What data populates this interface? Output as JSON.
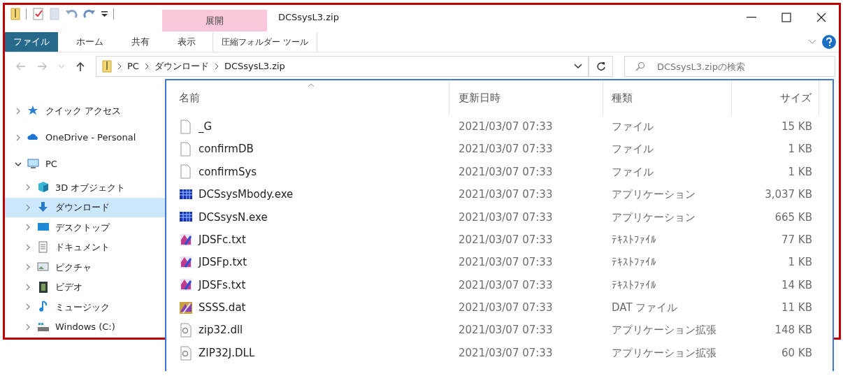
{
  "window": {
    "title": "DCSsysL3.zip"
  },
  "contextual_tab": {
    "group": "展開"
  },
  "ribbon_tabs": [
    {
      "label": "ファイル",
      "kind": "file"
    },
    {
      "label": "ホーム",
      "kind": "tab"
    },
    {
      "label": "共有",
      "kind": "tab"
    },
    {
      "label": "表示",
      "kind": "tab"
    },
    {
      "label": "圧縮フォルダー ツール",
      "kind": "contextual"
    }
  ],
  "address": {
    "crumbs": [
      "PC",
      "ダウンロード",
      "DCSsysL3.zip"
    ]
  },
  "search": {
    "placeholder": "DCSsysL3.zipの検索"
  },
  "nav_pane": {
    "items": [
      {
        "label": "クイック アクセス",
        "expanded": false,
        "selected": false
      },
      {
        "label": "OneDrive - Personal",
        "expanded": false,
        "selected": false
      },
      {
        "label": "PC",
        "expanded": true,
        "selected": false,
        "children": [
          {
            "label": "3D オブジェクト",
            "expanded": false,
            "selected": false
          },
          {
            "label": "ダウンロード",
            "expanded": false,
            "selected": true
          },
          {
            "label": "デスクトップ",
            "expanded": false,
            "selected": false
          },
          {
            "label": "ドキュメント",
            "expanded": false,
            "selected": false
          },
          {
            "label": "ピクチャ",
            "expanded": false,
            "selected": false
          },
          {
            "label": "ビデオ",
            "expanded": false,
            "selected": false
          },
          {
            "label": "ミュージック",
            "expanded": false,
            "selected": false
          },
          {
            "label": "Windows (C:)",
            "expanded": false,
            "selected": false
          }
        ]
      }
    ]
  },
  "file_list": {
    "columns": [
      {
        "label": "名前",
        "sorted": true
      },
      {
        "label": "更新日時",
        "sorted": false
      },
      {
        "label": "種類",
        "sorted": false
      },
      {
        "label": "サイズ",
        "sorted": false
      }
    ],
    "rows": [
      {
        "name": "_G",
        "modified": "2021/03/07 07:33",
        "type": "ファイル",
        "size": "15 KB",
        "kind": "file"
      },
      {
        "name": "confirmDB",
        "modified": "2021/03/07 07:33",
        "type": "ファイル",
        "size": "1 KB",
        "kind": "file"
      },
      {
        "name": "confirmSys",
        "modified": "2021/03/07 07:33",
        "type": "ファイル",
        "size": "1 KB",
        "kind": "file"
      },
      {
        "name": "DCSsysMbody.exe",
        "modified": "2021/03/07 07:33",
        "type": "アプリケーション",
        "size": "3,037 KB",
        "kind": "exe"
      },
      {
        "name": "DCSsysN.exe",
        "modified": "2021/03/07 07:33",
        "type": "アプリケーション",
        "size": "665 KB",
        "kind": "exe"
      },
      {
        "name": "JDSFc.txt",
        "modified": "2021/03/07 07:33",
        "type": "ﾃｷｽﾄﾌｧｲﾙ",
        "size": "77 KB",
        "kind": "txt"
      },
      {
        "name": "JDSFp.txt",
        "modified": "2021/03/07 07:33",
        "type": "ﾃｷｽﾄﾌｧｲﾙ",
        "size": "1 KB",
        "kind": "txt"
      },
      {
        "name": "JDSFs.txt",
        "modified": "2021/03/07 07:33",
        "type": "ﾃｷｽﾄﾌｧｲﾙ",
        "size": "14 KB",
        "kind": "txt"
      },
      {
        "name": "SSSS.dat",
        "modified": "2021/03/07 07:33",
        "type": "DAT ファイル",
        "size": "11 KB",
        "kind": "dat"
      },
      {
        "name": "zip32.dll",
        "modified": "2021/03/07 07:33",
        "type": "アプリケーション拡張",
        "size": "148 KB",
        "kind": "dll"
      },
      {
        "name": "ZIP32J.DLL",
        "modified": "2021/03/07 07:33",
        "type": "アプリケーション拡張",
        "size": "60 KB",
        "kind": "dll"
      }
    ]
  }
}
